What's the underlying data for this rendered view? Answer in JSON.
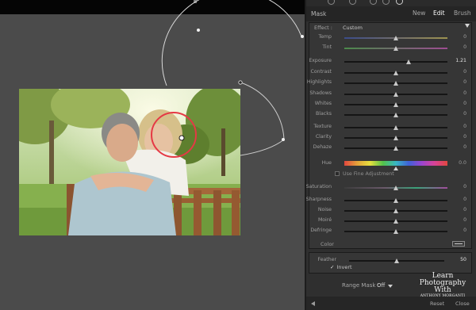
{
  "panel": {
    "mask_label": "Mask",
    "modes": [
      {
        "label": "New",
        "active": false
      },
      {
        "label": "Edit",
        "active": true
      },
      {
        "label": "Brush",
        "active": false
      }
    ],
    "effect": {
      "label": "Effect :",
      "value": "Custom"
    },
    "sliders": [
      {
        "label": "Temp",
        "value": "0",
        "position": 0.5,
        "track": "temp"
      },
      {
        "label": "Tint",
        "value": "0",
        "position": 0.5,
        "track": "tint"
      },
      {
        "label": "Exposure",
        "value": "1.21",
        "position": 0.62,
        "track": "plain"
      },
      {
        "label": "Contrast",
        "value": "0",
        "position": 0.5,
        "track": "plain"
      },
      {
        "label": "Highlights",
        "value": "0",
        "position": 0.5,
        "track": "plain"
      },
      {
        "label": "Shadows",
        "value": "0",
        "position": 0.5,
        "track": "plain"
      },
      {
        "label": "Whites",
        "value": "0",
        "position": 0.5,
        "track": "plain"
      },
      {
        "label": "Blacks",
        "value": "0",
        "position": 0.5,
        "track": "plain"
      },
      {
        "label": "Texture",
        "value": "0",
        "position": 0.5,
        "track": "plain"
      },
      {
        "label": "Clarity",
        "value": "0",
        "position": 0.5,
        "track": "plain"
      },
      {
        "label": "Dehaze",
        "value": "0",
        "position": 0.5,
        "track": "plain"
      }
    ],
    "hue": {
      "label": "Hue",
      "value": "0.0",
      "position": 0.5
    },
    "fine_adjustment_label": "Use Fine Adjustment",
    "sliders_b": [
      {
        "label": "Saturation",
        "value": "0",
        "position": 0.5,
        "track": "sat"
      },
      {
        "label": "Sharpness",
        "value": "0",
        "position": 0.5,
        "track": "plain"
      },
      {
        "label": "Noise",
        "value": "0",
        "position": 0.5,
        "track": "plain"
      },
      {
        "label": "Moiré",
        "value": "0",
        "position": 0.5,
        "track": "plain"
      },
      {
        "label": "Defringe",
        "value": "0",
        "position": 0.5,
        "track": "plain"
      }
    ],
    "color_label": "Color",
    "feather": {
      "label": "Feather",
      "value": "50",
      "position": 0.5
    },
    "invert": {
      "label": "Invert",
      "checked": true,
      "check_glyph": "✓"
    },
    "range_mask": {
      "label": "Range Mask :",
      "value": "Off"
    },
    "bottom": {
      "reset_label": "Reset",
      "close_label": "Close"
    }
  },
  "watermark": {
    "line1": "Learn",
    "line2": "Photography",
    "line3": "With",
    "line4": "ANTHONY MORGANTI"
  },
  "colors": {
    "panel": "#2f2f2f",
    "workspace": "#4b4b4b",
    "mask_circle": "#e53945",
    "overlay_line": "#d9d9d9"
  }
}
